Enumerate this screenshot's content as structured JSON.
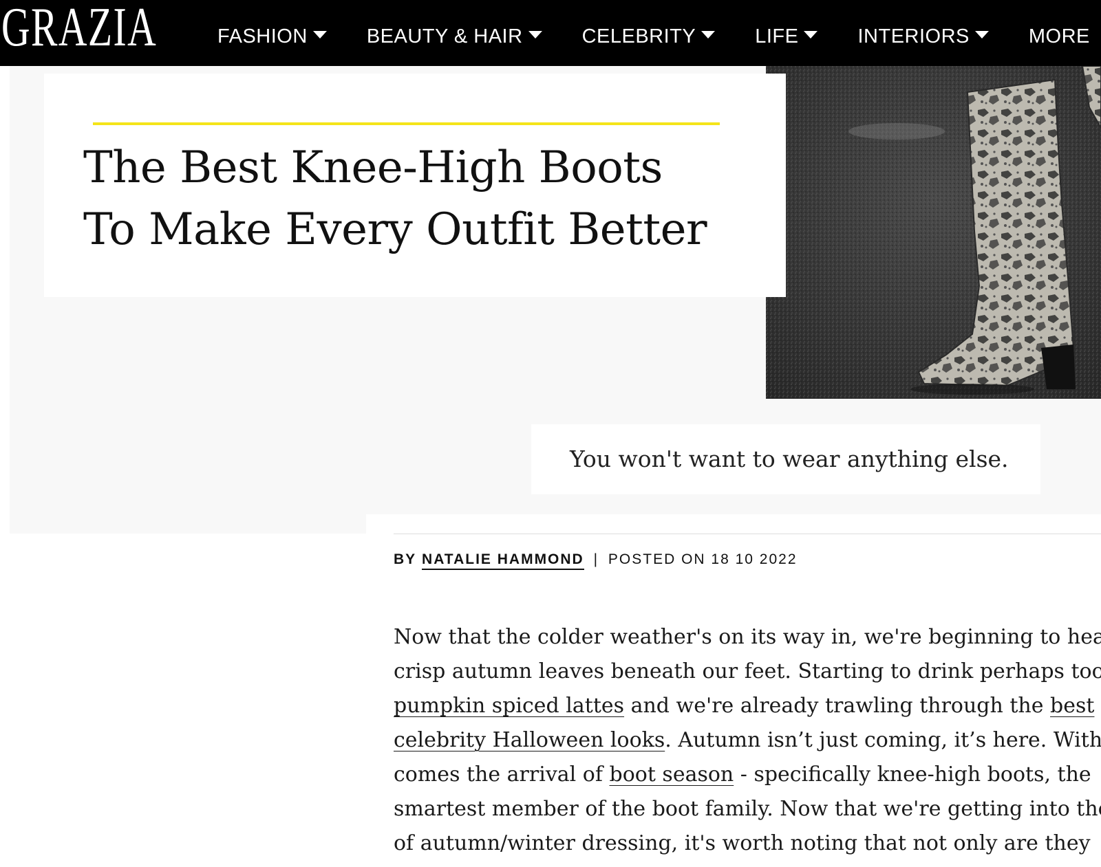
{
  "site": {
    "logo": "GRAZIA"
  },
  "nav": {
    "items": [
      {
        "label": "FASHION"
      },
      {
        "label": "BEAUTY & HAIR"
      },
      {
        "label": "CELEBRITY"
      },
      {
        "label": "LIFE"
      },
      {
        "label": "INTERIORS"
      },
      {
        "label": "MORE"
      }
    ]
  },
  "article": {
    "title_line1": "The Best Knee-High Boots",
    "title_line2": "To Make Every Outfit Better",
    "subtitle": "You won't want to wear anything else.",
    "byline": {
      "by": "BY",
      "author": "NATALIE HAMMOND",
      "separator": "|",
      "posted": "POSTED ON 18 10 2022"
    },
    "body": {
      "line1": "Now that the colder weather's on its way in, we're beginning to hear",
      "line2": "crisp autumn leaves beneath our feet. Starting to drink perhaps too many",
      "line3_link": "pumpkin spiced lattes",
      "line3_text": " and we're already trawling through the ",
      "line3_link2": "best",
      "line4_link": "celebrity Halloween looks",
      "line4_text": ". Autumn isn’t just coming, it’s here. With it",
      "line5_text": "comes the arrival of ",
      "line5_link": "boot season",
      "line5_text2": " - specifically knee-high boots, the",
      "line6": "smartest member of the boot family. Now that we're getting into the swing",
      "line7": "of autumn/winter dressing, it's worth noting that not only are they"
    }
  },
  "colors": {
    "accent": "#f4e419",
    "nav_bg": "#000000",
    "hero_bg": "#f8f8f8"
  }
}
